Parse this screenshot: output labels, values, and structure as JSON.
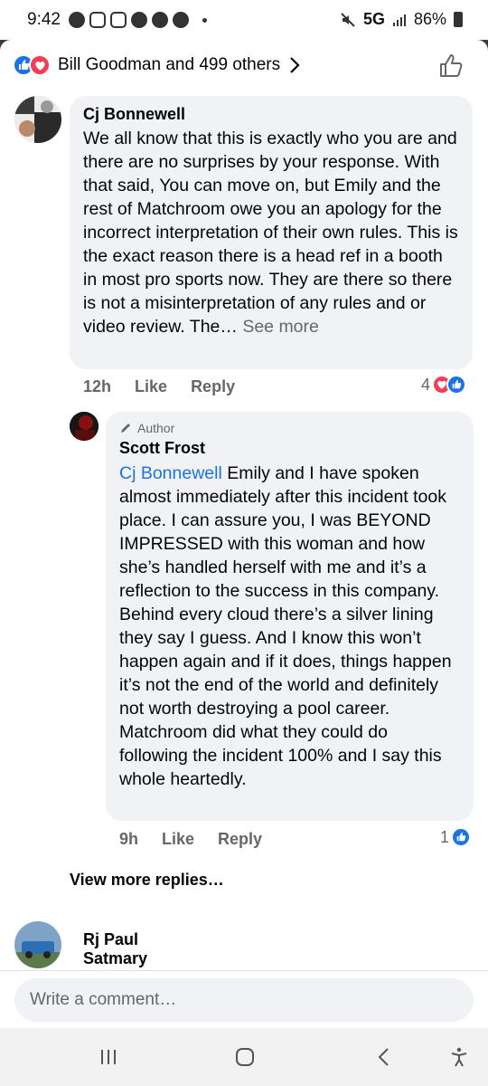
{
  "status_bar": {
    "time": "9:42",
    "network": "5G",
    "battery": "86%"
  },
  "post": {
    "reactors_text": "Bill Goodman and 499 others"
  },
  "comments": [
    {
      "author": "Cj Bonnewell",
      "text": "We all know that this is exactly who you are and there are no surprises by your response. With that said, You can move on, but Emily and the rest of Matchroom owe you an apology for the incorrect interpretation of their own rules. This is the exact reason there is a head ref in a booth in most pro sports now. They are there so there is not a misinterpretation of any rules and or video review. The…",
      "see_more": "See more",
      "time": "12h",
      "like_label": "Like",
      "reply_label": "Reply",
      "reaction_count": "4"
    }
  ],
  "reply": {
    "badge": "Author",
    "author": "Scott Frost",
    "mention": "Cj Bonnewell",
    "text": "Emily and I have spoken almost immediately after this incident took place. I can assure you, I was BEYOND IMPRESSED with this woman and how she’s handled herself with me and it’s a reflection to the success in this company. Behind every cloud there’s a silver lining they say I guess. And I know this won’t happen again and if it does, things happen it’s not the end of the world and definitely not worth destroying a pool career. Matchroom did what they could do following the incident 100% and I say this whole heartedly.",
    "time": "9h",
    "like_label": "Like",
    "reply_label": "Reply",
    "reaction_count": "1"
  },
  "view_more_replies": "View more replies…",
  "next_comment": {
    "author": "Rj Paul Satmary"
  },
  "composer": {
    "placeholder": "Write a comment…"
  },
  "colors": {
    "accent_blue": "#1b74e4",
    "love_red": "#f33e58",
    "bubble_gray": "#f0f2f5",
    "meta_gray": "#65676b"
  },
  "icons": [
    "like-reaction-icon",
    "love-reaction-icon",
    "chevron-right-icon",
    "thumbs-up-icon",
    "pencil-icon",
    "recent-apps-icon",
    "home-icon",
    "back-icon",
    "accessibility-icon"
  ]
}
